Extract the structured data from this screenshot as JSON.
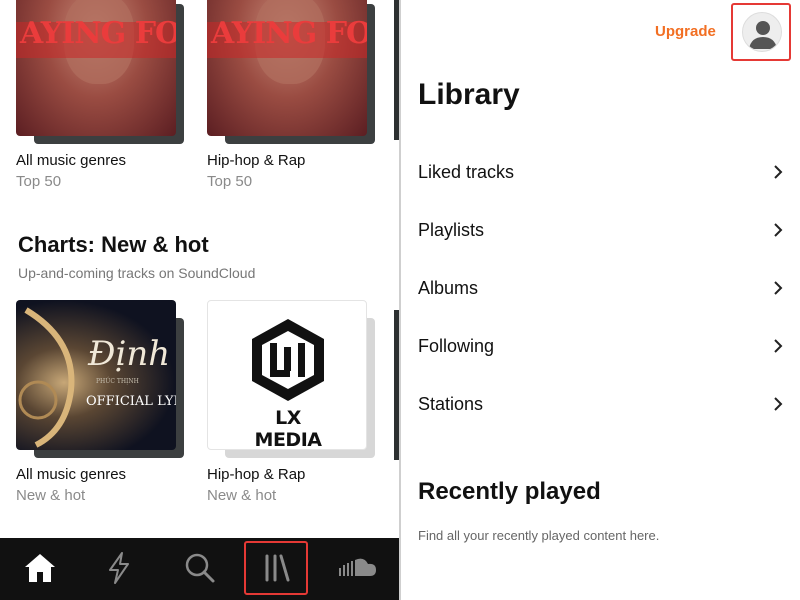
{
  "left": {
    "top_cards": [
      {
        "title": "All music genres",
        "subtitle": "Top 50",
        "art_text": "AYING FOR Y"
      },
      {
        "title": "Hip-hop & Rap",
        "subtitle": "Top 50",
        "art_text": "AYING FOR Y"
      }
    ],
    "section": {
      "title": "Charts: New & hot",
      "subtitle": "Up-and-coming tracks on SoundCloud"
    },
    "chart_cards": [
      {
        "title": "All music genres",
        "subtitle": "New & hot",
        "art_script": "Định",
        "art_small": "PHÚC THỊNH",
        "art_lyric": "OFFICIAL LYRIC"
      },
      {
        "title": "Hip-hop & Rap",
        "subtitle": "New & hot",
        "art_label": "LX MEDIA"
      }
    ]
  },
  "bottom_nav": {
    "items": [
      "home-icon",
      "lightning-icon",
      "search-icon",
      "library-icon",
      "soundcloud-icon"
    ],
    "active": "library-icon"
  },
  "library": {
    "upgrade_label": "Upgrade",
    "title": "Library",
    "items": [
      {
        "label": "Liked tracks"
      },
      {
        "label": "Playlists"
      },
      {
        "label": "Albums"
      },
      {
        "label": "Following"
      },
      {
        "label": "Stations"
      }
    ],
    "recent_title": "Recently played",
    "recent_subtitle": "Find all your recently played content here."
  },
  "colors": {
    "accent": "#f26f23",
    "highlight_border": "#e53935",
    "nav_background": "#111111"
  }
}
